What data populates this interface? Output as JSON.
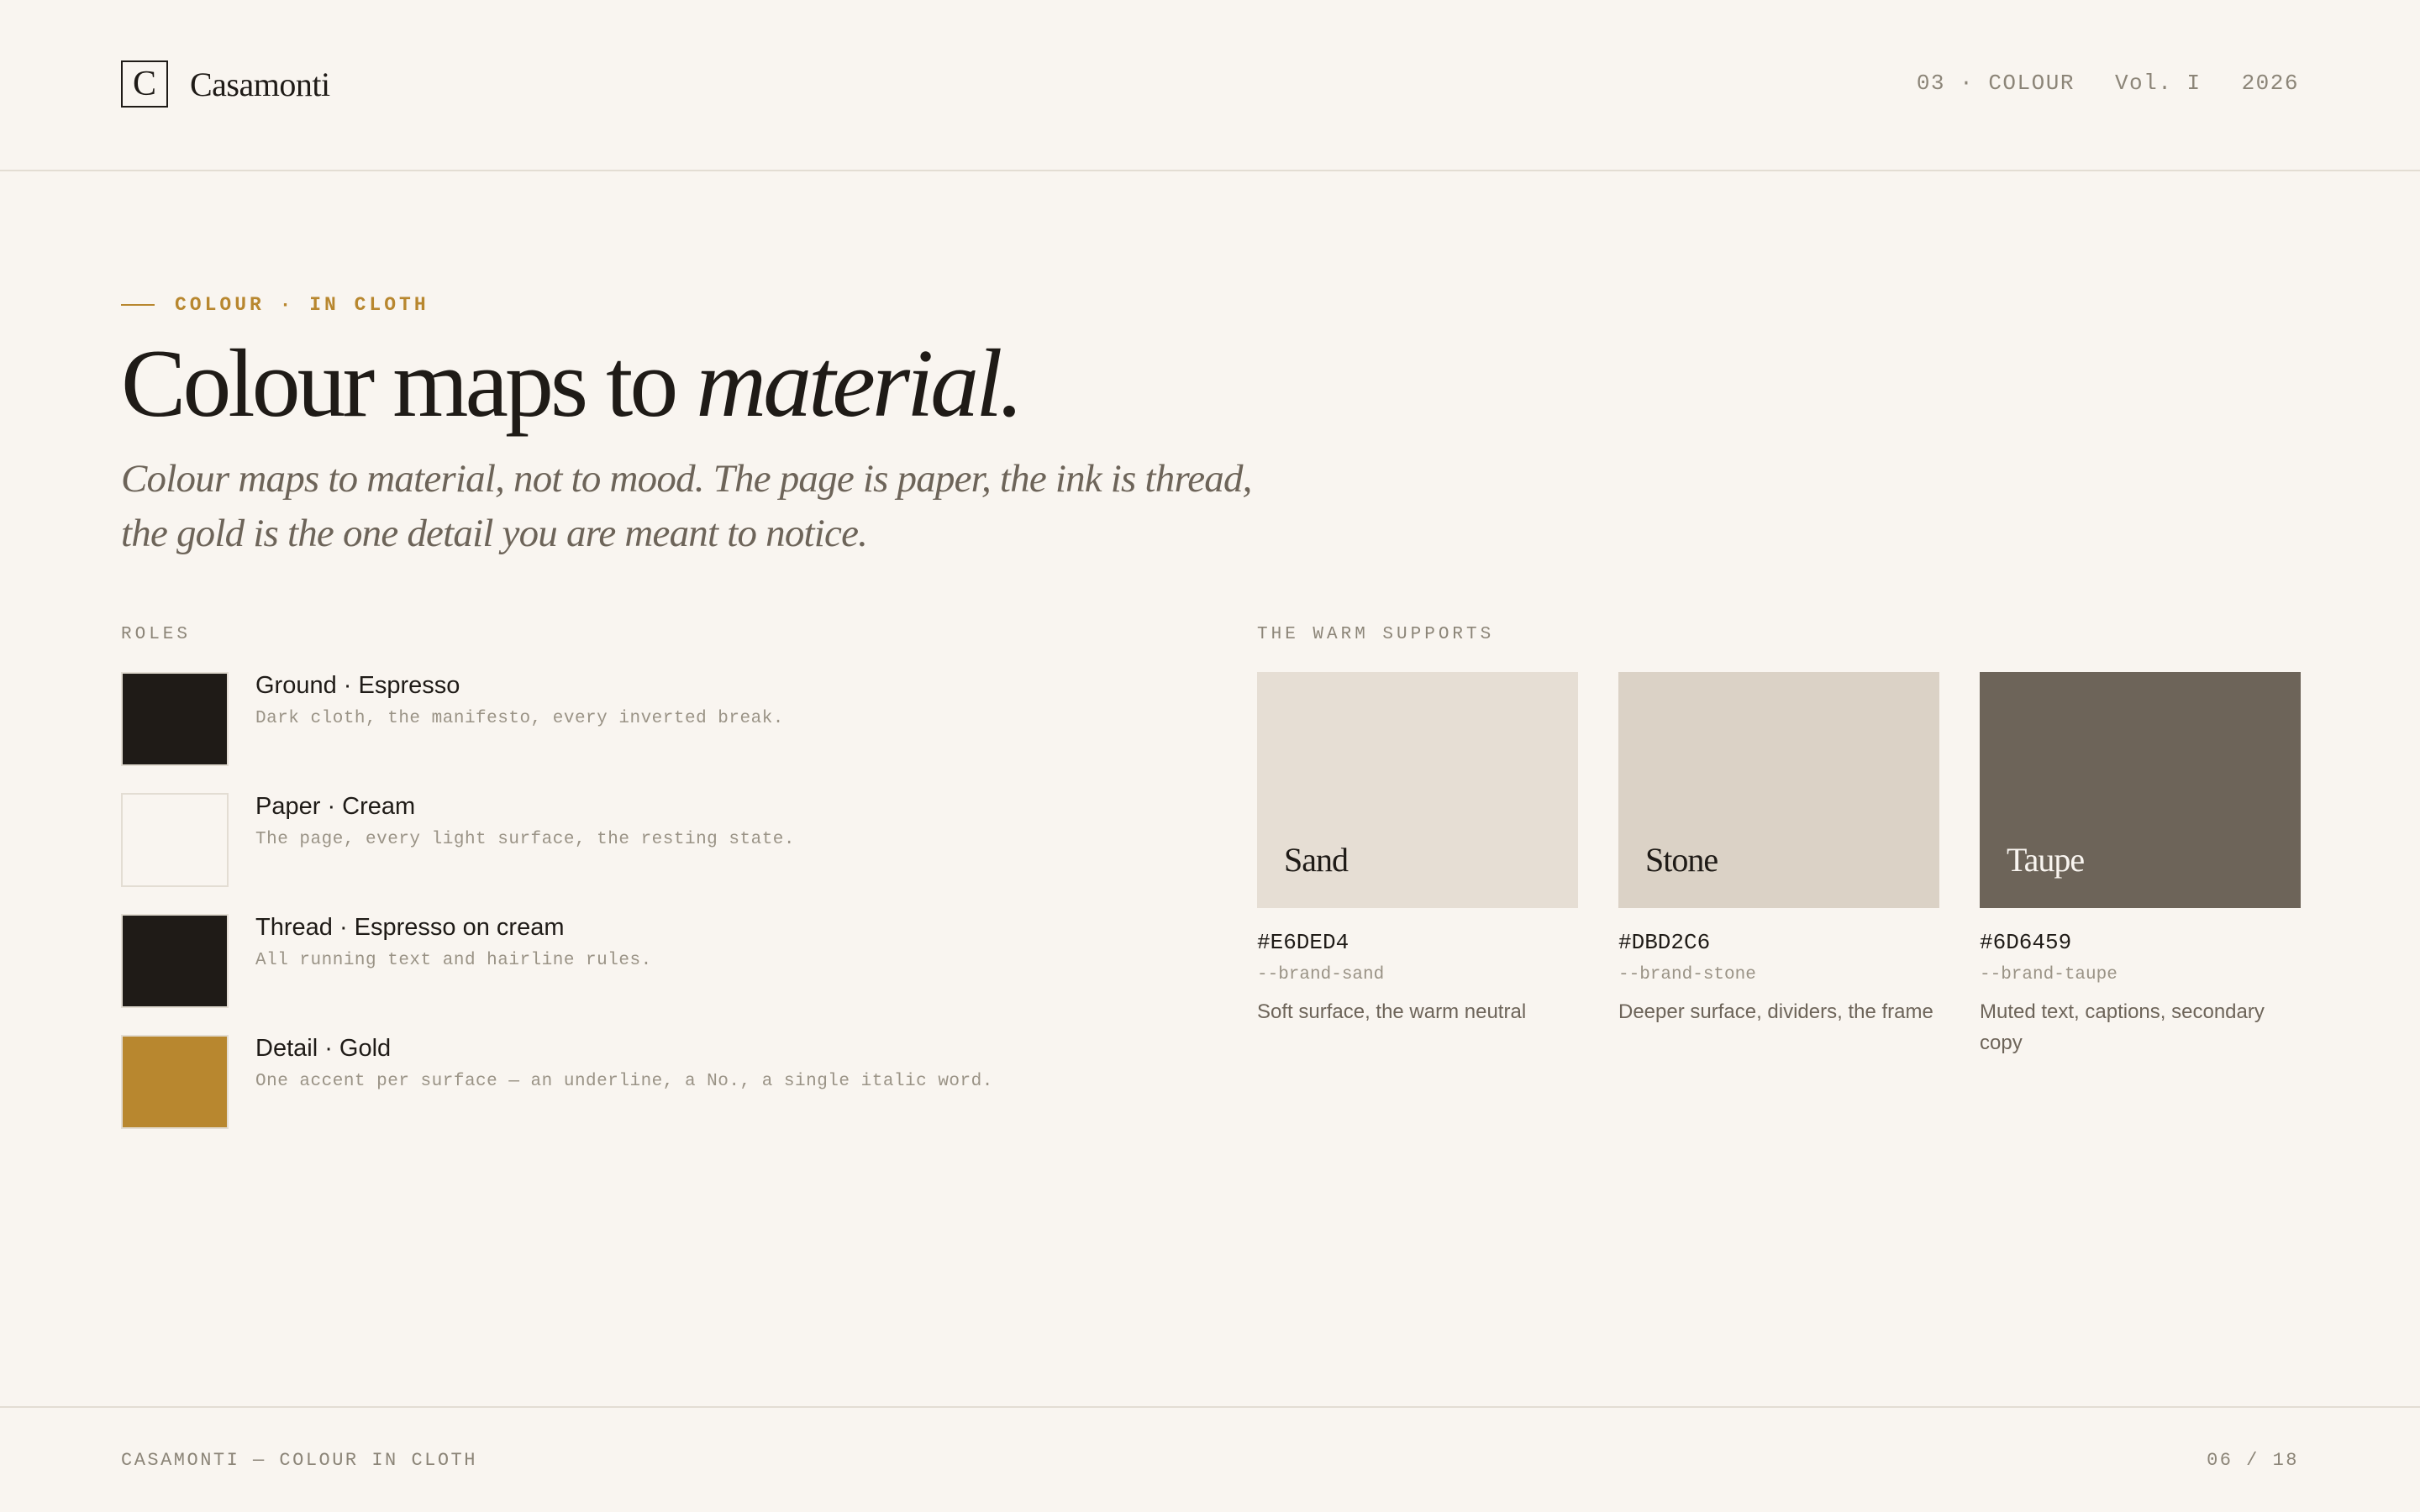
{
  "header": {
    "logo_letter": "C",
    "brand": "Casamonti",
    "section": "03 · COLOUR",
    "volume": "Vol. I",
    "year": "2026"
  },
  "hero": {
    "eyebrow": "COLOUR · IN CLOTH",
    "title_plain": "Colour maps to ",
    "title_italic": "material.",
    "lede": "Colour maps to material, not to mood. The page is paper, the ink is thread, the gold is the one detail you are meant to notice."
  },
  "roles": {
    "label": "ROLES",
    "items": [
      {
        "name": "Ground · Espresso",
        "desc": "Dark cloth, the manifesto, every inverted break.",
        "color": "#1F1B17"
      },
      {
        "name": "Paper · Cream",
        "desc": "The page, every light surface, the resting state.",
        "color": "#F9F5F0"
      },
      {
        "name": "Thread · Espresso on cream",
        "desc": "All running text and hairline rules.",
        "color": "#1F1B17"
      },
      {
        "name": "Detail · Gold",
        "desc": "One accent per surface — an underline, a No., a single italic word.",
        "color": "#B8872F"
      }
    ]
  },
  "supports": {
    "label": "THE WARM SUPPORTS",
    "items": [
      {
        "name": "Sand",
        "hex": "#E6DED4",
        "token": "--brand-sand",
        "desc": "Soft surface, the warm neutral",
        "color": "#E6DED4",
        "text_color": "#1F1B17"
      },
      {
        "name": "Stone",
        "hex": "#DBD2C6",
        "token": "--brand-stone",
        "desc": "Deeper surface, dividers, the frame",
        "color": "#DBD2C6",
        "text_color": "#1F1B17"
      },
      {
        "name": "Taupe",
        "hex": "#6D6459",
        "token": "--brand-taupe",
        "desc": "Muted text, captions, secondary copy",
        "color": "#6D6459",
        "text_color": "#F9F5F0"
      }
    ]
  },
  "footer": {
    "left": "CASAMONTI — COLOUR IN CLOTH",
    "page": "06 / 18"
  }
}
